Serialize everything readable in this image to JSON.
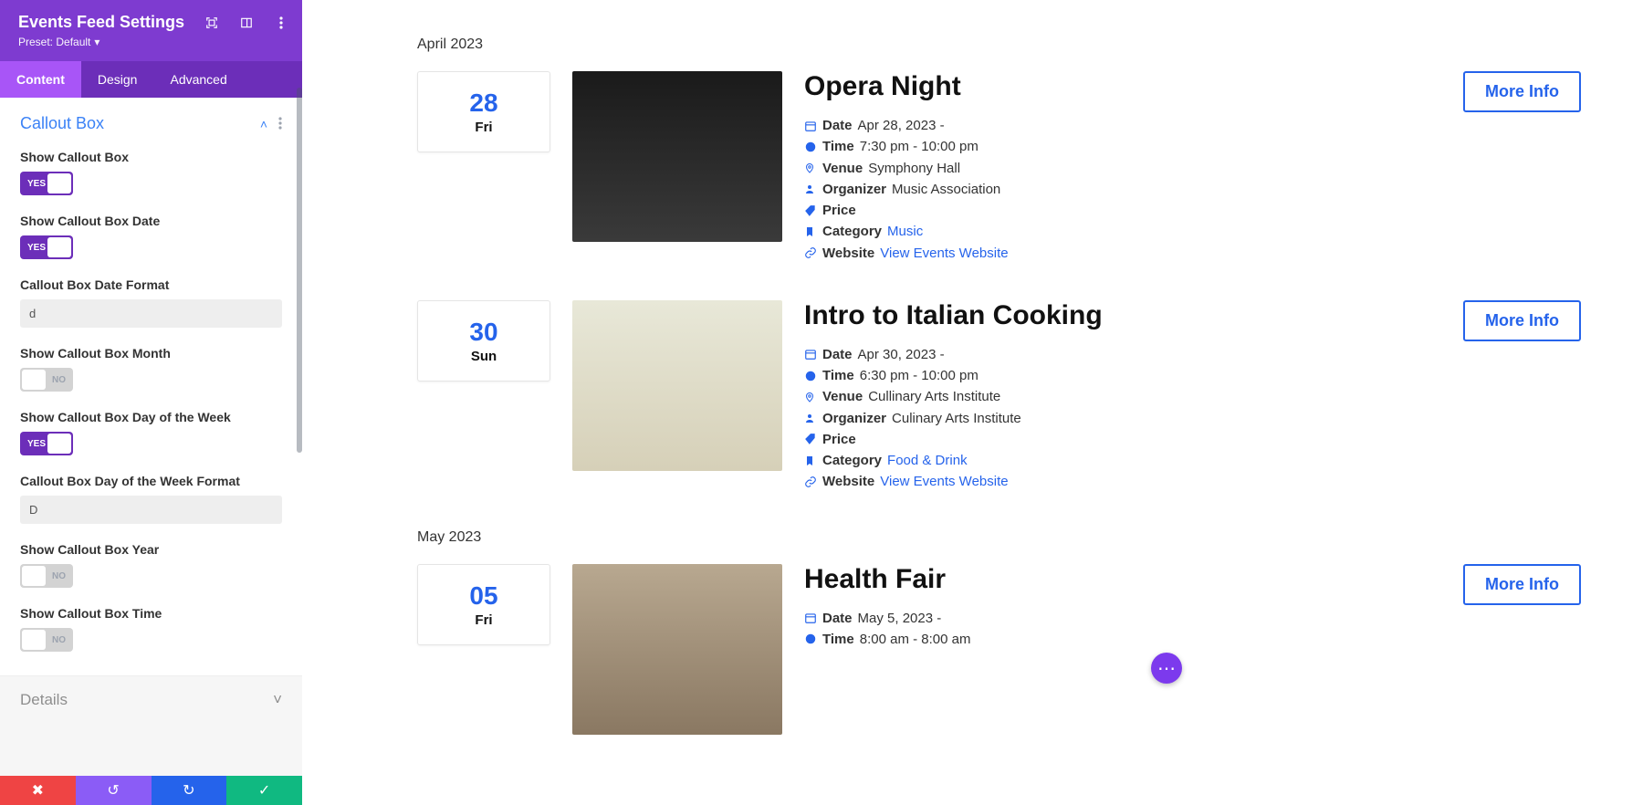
{
  "panel": {
    "title": "Events Feed Settings",
    "preset_label": "Preset: Default",
    "tabs": [
      "Content",
      "Design",
      "Advanced"
    ],
    "active_tab": 0
  },
  "section": {
    "title": "Callout Box",
    "settings": [
      {
        "key": "show_callout",
        "label": "Show Callout Box",
        "type": "toggle",
        "value": true
      },
      {
        "key": "show_date",
        "label": "Show Callout Box Date",
        "type": "toggle",
        "value": true
      },
      {
        "key": "date_format",
        "label": "Callout Box Date Format",
        "type": "text",
        "value": "d"
      },
      {
        "key": "show_month",
        "label": "Show Callout Box Month",
        "type": "toggle",
        "value": false
      },
      {
        "key": "show_dow",
        "label": "Show Callout Box Day of the Week",
        "type": "toggle",
        "value": true
      },
      {
        "key": "dow_format",
        "label": "Callout Box Day of the Week Format",
        "type": "text",
        "value": "D"
      },
      {
        "key": "show_year",
        "label": "Show Callout Box Year",
        "type": "toggle",
        "value": false
      },
      {
        "key": "show_time",
        "label": "Show Callout Box Time",
        "type": "toggle",
        "value": false
      }
    ],
    "next_section": "Details",
    "yes": "YES",
    "no": "NO"
  },
  "labels": {
    "date": "Date",
    "time": "Time",
    "venue": "Venue",
    "organizer": "Organizer",
    "price": "Price",
    "category": "Category",
    "website": "Website",
    "more_info": "More Info",
    "view_website": "View Events Website"
  },
  "months": [
    {
      "label": "April 2023",
      "events": [
        {
          "title": "Opera Night",
          "day": "28",
          "dow": "Fri",
          "thumb": "opera",
          "date": "Apr 28, 2023 -",
          "time": "7:30 pm - 10:00 pm",
          "venue": "Symphony Hall",
          "organizer": "Music Association",
          "price": "",
          "category": "Music"
        },
        {
          "title": "Intro to Italian Cooking",
          "day": "30",
          "dow": "Sun",
          "thumb": "food",
          "date": "Apr 30, 2023 -",
          "time": "6:30 pm - 10:00 pm",
          "venue": "Cullinary Arts Institute",
          "organizer": "Culinary Arts Institute",
          "price": "",
          "category": "Food & Drink"
        }
      ]
    },
    {
      "label": "May 2023",
      "events": [
        {
          "title": "Health Fair",
          "day": "05",
          "dow": "Fri",
          "thumb": "health",
          "date": "May 5, 2023 -",
          "time": "8:00 am - 8:00 am",
          "venue": "",
          "organizer": "",
          "price": "",
          "category": ""
        }
      ]
    }
  ]
}
